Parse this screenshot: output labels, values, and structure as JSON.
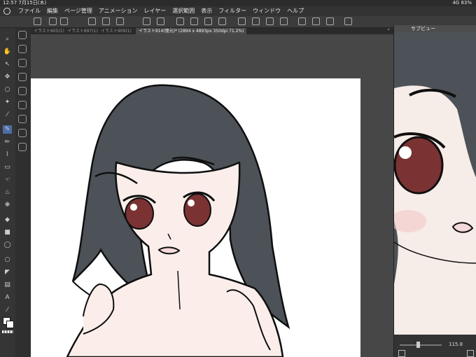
{
  "status": {
    "time": "12:57",
    "date": "7月15日(木)",
    "network": "4G",
    "battery": "83%"
  },
  "menu": [
    "ファイル",
    "編集",
    "ページ管理",
    "アニメーション",
    "レイヤー",
    "選択範囲",
    "表示",
    "フィルター",
    "ウィンドウ",
    "ヘルプ"
  ],
  "tabs": [
    {
      "label": "イラスト905(1)",
      "active": false
    },
    {
      "label": "イラスト897(1)",
      "active": false
    },
    {
      "label": "イラスト909(1)",
      "active": false
    },
    {
      "label": "イラスト914(復元)* (2894 x 4893px 350dpi 71.2%)",
      "active": true
    }
  ],
  "subview": {
    "title": "サブビュー",
    "zoom": "115.8"
  },
  "colors": {
    "hair": "#4c5257",
    "skin": "#fbeeea",
    "eye": "#7b3233",
    "accent": "#4b6ea8"
  }
}
